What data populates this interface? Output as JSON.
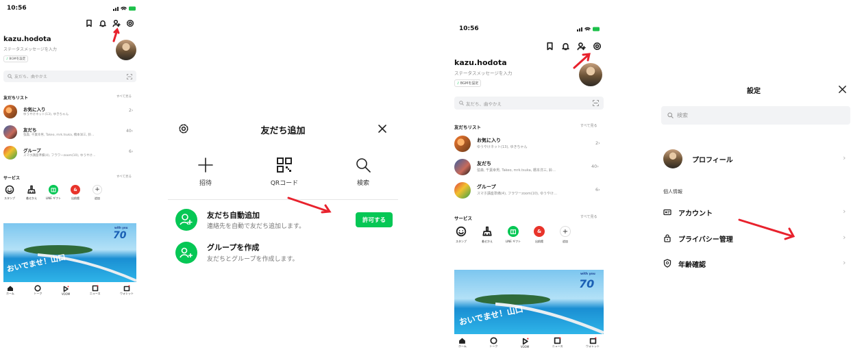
{
  "home": {
    "time": "10:56",
    "username": "kazu.hodota",
    "status_placeholder": "ステータスメッセージを入力",
    "bgm_label": "BGMを設定",
    "search_placeholder": "友だち、曲やかえ",
    "friends_title": "友だちリスト",
    "see_all": "すべて見る",
    "friend_rows": [
      {
        "title": "お気に入り",
        "sub": "ゆうやけネット(13), ゆきちゃん",
        "count": "2"
      },
      {
        "title": "友だち",
        "sub": "弦森, 千葉幸男, Takeo, mrk.tsuka, 橋本洋三, 鈴…",
        "count": "40"
      },
      {
        "title": "グループ",
        "sub": "スマホ講座準備(4), フラワーzoom(10), ゆうやけ…",
        "count": "6"
      }
    ],
    "services_title": "サービス",
    "services": [
      "スタンプ",
      "着せかえ",
      "LINE ギフト",
      "出前館",
      "追加"
    ],
    "banner_text": "おいでませ！山口",
    "badge_small": "with you",
    "badge_num": "70",
    "tabs": [
      "ホーム",
      "トーク",
      "VOOM",
      "ニュース",
      "ウォレット"
    ]
  },
  "add_friend": {
    "title": "友だち追加",
    "options": [
      "招待",
      "QRコード",
      "検索"
    ],
    "auto_title": "友だち自動追加",
    "auto_sub": "連絡先を自動で友だち追加します。",
    "allow_button": "許可する",
    "group_title": "グループを作成",
    "group_sub": "友だちとグループを作成します。"
  },
  "settings": {
    "title": "設定",
    "search_placeholder": "検索",
    "profile_label": "プロフィール",
    "section_personal": "個人情報",
    "items": [
      "アカウント",
      "プライバシー管理",
      "年齢確認"
    ]
  },
  "colors": {
    "accent": "#06c755",
    "arrow": "#e8222d"
  }
}
